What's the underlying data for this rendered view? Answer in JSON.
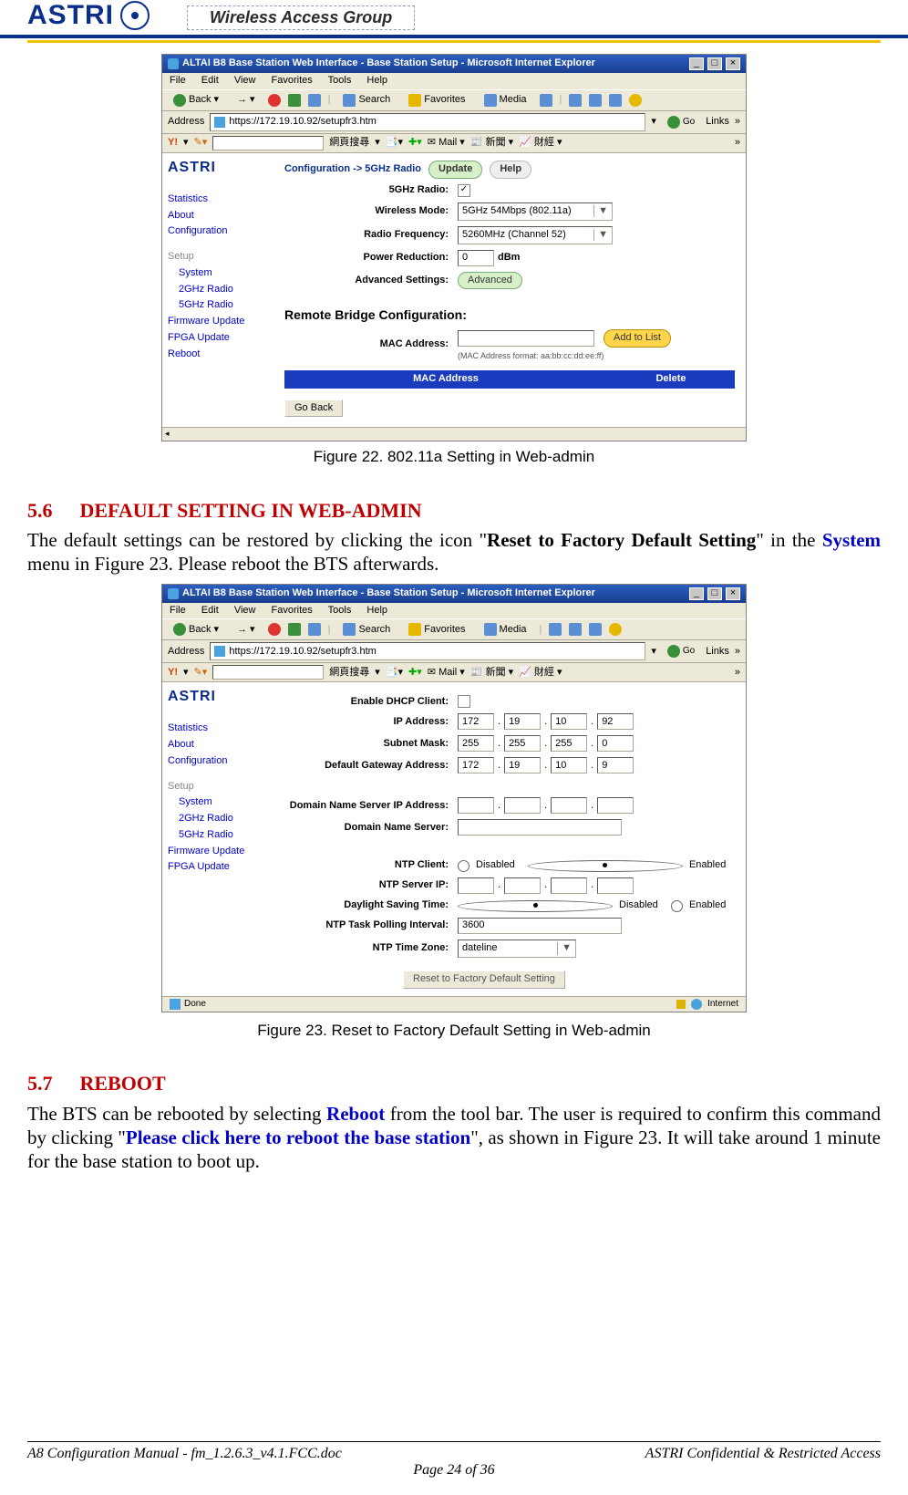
{
  "header": {
    "logo": "ASTRI",
    "wag": "Wireless Access Group"
  },
  "fig22": {
    "caption": "Figure 22. 802.11a Setting in Web-admin",
    "titlebar": "ALTAI B8 Base Station Web Interface - Base Station Setup - Microsoft Internet Explorer",
    "menu": {
      "file": "File",
      "edit": "Edit",
      "view": "View",
      "fav": "Favorites",
      "tools": "Tools",
      "help": "Help"
    },
    "tb": {
      "back": "Back",
      "search": "Search",
      "favorites": "Favorites",
      "media": "Media"
    },
    "addr": {
      "label": "Address",
      "value": "https://172.19.10.92/setupfr3.htm",
      "go": "Go",
      "links": "Links"
    },
    "ytb": {
      "yb": "Y!",
      "cj1": "網頁搜尋",
      "mail": "Mail",
      "news": "新聞",
      "fin": "財經"
    },
    "side": {
      "logo": "ASTRI",
      "statistics": "Statistics",
      "about": "About",
      "configuration": "Configuration",
      "setup": "Setup",
      "system": "System",
      "g2": "2GHz Radio",
      "g5": "5GHz Radio",
      "fw": "Firmware Update",
      "fpga": "FPGA Update",
      "reboot": "Reboot"
    },
    "main": {
      "breadcrumb": "Configuration -> 5GHz Radio",
      "update_btn": "Update",
      "help_btn": "Help",
      "r_radio": "5GHz Radio:",
      "r_mode": "Wireless Mode:",
      "r_mode_val": "5GHz 54Mbps (802.11a)",
      "r_freq": "Radio Frequency:",
      "r_freq_val": "5260MHz (Channel 52)",
      "r_power": "Power Reduction:",
      "r_power_val": "0",
      "r_power_unit": "dBm",
      "r_adv": "Advanced Settings:",
      "r_adv_btn": "Advanced",
      "remote_hdr": "Remote Bridge Configuration:",
      "mac_lbl": "MAC Address:",
      "mac_note": "(MAC Address format: aa:bb:cc:dd:ee:ff)",
      "add_btn": "Add to List",
      "tbl_mac": "MAC Address",
      "tbl_del": "Delete",
      "goback": "Go Back"
    }
  },
  "s56": {
    "num": "5.6",
    "title": "DEFAULT SETTING IN WEB-ADMIN",
    "p1a": "The default settings can be restored by clicking the icon \"",
    "p1b": "Reset to Factory Default Setting",
    "p1c": "\" in the ",
    "p1d": "System",
    "p1e": " menu in Figure 23. Please reboot the BTS afterwards."
  },
  "fig23": {
    "caption": "Figure 23. Reset to Factory Default Setting in Web-admin",
    "titlebar": "ALTAI B8 Base Station Web Interface - Base Station Setup - Microsoft Internet Explorer",
    "addr_value": "https://172.19.10.92/setupfr3.htm",
    "main": {
      "dhcp": "Enable DHCP Client:",
      "ip": "IP Address:",
      "ip1": "172",
      "ip2": "19",
      "ip3": "10",
      "ip4": "92",
      "mask": "Subnet Mask:",
      "m1": "255",
      "m2": "255",
      "m3": "255",
      "m4": "0",
      "gw": "Default Gateway Address:",
      "g1": "172",
      "g2": "19",
      "g3": "10",
      "g4": "9",
      "dnsip": "Domain Name Server IP Address:",
      "dns": "Domain Name Server:",
      "ntpc": "NTP Client:",
      "dis": "Disabled",
      "en": "Enabled",
      "ntps": "NTP Server IP:",
      "dst": "Daylight Saving Time:",
      "poll": "NTP Task Polling Interval:",
      "poll_v": "3600",
      "tz": "NTP Time Zone:",
      "tz_v": "dateline",
      "factory": "Reset to Factory Default Setting"
    },
    "status": {
      "done": "Done",
      "inet": "Internet"
    }
  },
  "s57": {
    "num": "5.7",
    "title": "REBOOT",
    "p1a": "The BTS can be rebooted by selecting ",
    "p1b": "Reboot",
    "p1c": " from the tool bar. The user is required to confirm this command by clicking \"",
    "p1d": "Please click here to reboot the base station",
    "p1e": "\", as shown in Figure 23. It will take around 1 minute for the base station to boot up."
  },
  "footer": {
    "left": "A8 Configuration Manual - fm_1.2.6.3_v4.1.FCC.doc",
    "right": "ASTRI Confidential & Restricted Access",
    "page": "Page 24 of 36"
  }
}
